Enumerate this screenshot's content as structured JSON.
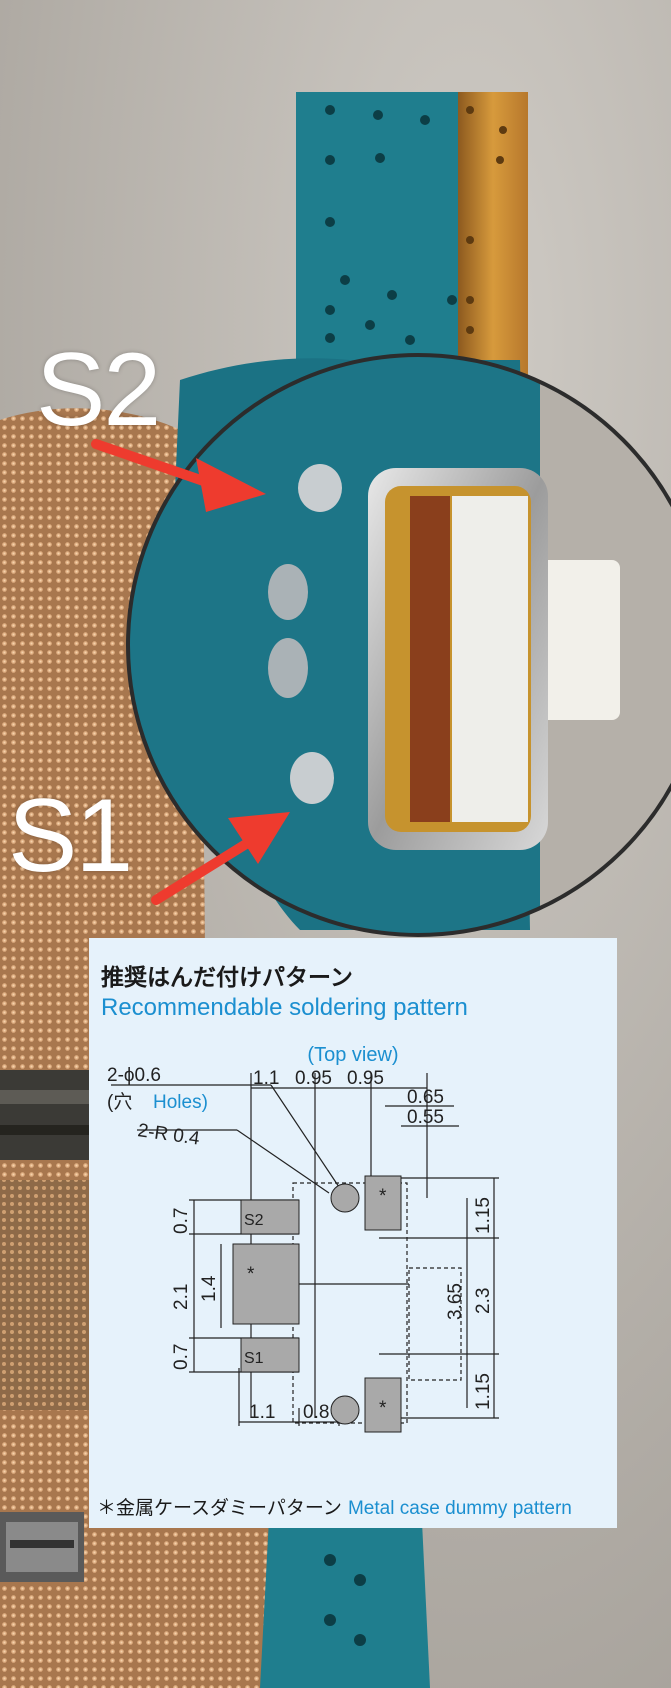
{
  "photo": {
    "label_s2": "S2",
    "label_s1": "S1",
    "arrow_color": "#ee3b2e",
    "board_color": "#1e7a8a"
  },
  "diagram": {
    "title_jp": "推奨はんだ付けパターン",
    "title_en": "Recommendable soldering pattern",
    "view_label": "(Top view)",
    "holes_label_1": "2-ϕ0.6",
    "holes_label_2_jp": "(穴",
    "holes_label_2_en": "Holes)",
    "radius_label": "2-R 0.4",
    "pad_s2": "S2",
    "pad_s1": "S1",
    "pad_star": "*",
    "dims": {
      "d_1_1_top": "1.1",
      "d_0_95_a": "0.95",
      "d_0_95_b": "0.95",
      "d_0_65": "0.65",
      "d_0_55": "0.55",
      "d_0_7_top": "0.7",
      "d_2_1": "2.1",
      "d_1_4": "1.4",
      "d_0_7_bottom": "0.7",
      "d_3_65": "3.65",
      "d_1_15_top": "1.15",
      "d_2_3": "2.3",
      "d_1_15_bottom": "1.15",
      "d_1_1_bottom": "1.1",
      "d_0_8": "0.8"
    },
    "footnote_jp": "＊金属ケースダミーパターン",
    "footnote_en": "Metal case dummy pattern",
    "accent_color": "#1b8fd0",
    "panel_color": "#e6f2fb"
  }
}
